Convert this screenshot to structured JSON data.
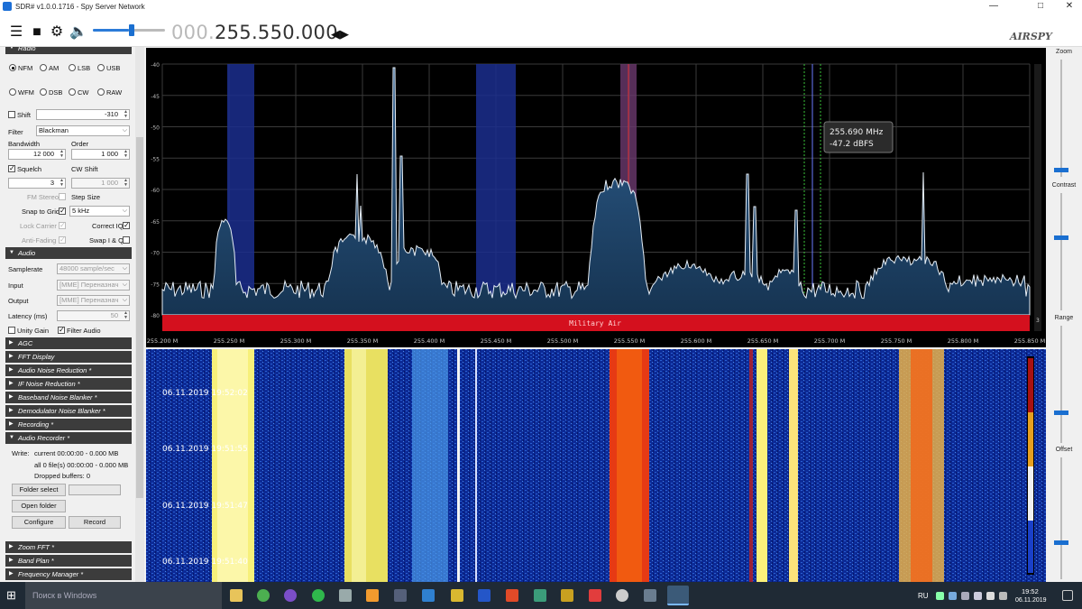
{
  "window": {
    "title": "SDR# v1.0.0.1716 - Spy Server Network",
    "minimize": "—",
    "maximize": "□",
    "close": "✕"
  },
  "toolbar": {
    "freq_dim": "000.",
    "freq_main": "255.550.000",
    "freq_arrows": "◀▶",
    "logo": "AIRSPY",
    "volume_level": 0.5
  },
  "radio": {
    "panel_title": "Radio",
    "modes": [
      "NFM",
      "AM",
      "LSB",
      "USB",
      "WFM",
      "DSB",
      "CW",
      "RAW"
    ],
    "selected_mode": "NFM",
    "shift_label": "Shift",
    "shift_value": "-310",
    "filter_label": "Filter",
    "filter_value": "Blackman",
    "bandwidth_label": "Bandwidth",
    "bandwidth_value": "12 000",
    "order_label": "Order",
    "order_value": "1 000",
    "squelch_label": "Squelch",
    "squelch_value": "3",
    "cw_shift_label": "CW Shift",
    "cw_shift_value": "1 000",
    "fm_stereo_label": "FM Stereo",
    "step_size_label": "Step Size",
    "snap_label": "Snap to Grid",
    "snap_value": "5 kHz",
    "lock_carrier_label": "Lock Carrier",
    "correct_iq_label": "Correct IQ",
    "anti_fading_label": "Anti-Fading",
    "swap_iq_label": "Swap I & Q"
  },
  "audio": {
    "panel_title": "Audio",
    "samplerate_label": "Samplerate",
    "samplerate_value": "48000 sample/sec",
    "input_label": "Input",
    "input_value": "[MME] Переназнач",
    "output_label": "Output",
    "output_value": "[MME] Переназнач",
    "latency_label": "Latency (ms)",
    "latency_value": "50",
    "unity_gain_label": "Unity Gain",
    "filter_audio_label": "Filter Audio"
  },
  "panels": [
    "AGC",
    "FFT Display",
    "Audio Noise Reduction *",
    "IF Noise Reduction *",
    "Baseband Noise Blanker *",
    "Demodulator Noise Blanker *",
    "Recording *"
  ],
  "recorder": {
    "panel_title": "Audio Recorder *",
    "write_label": "Write:",
    "current": "current 00:00:00 - 0.000 MB",
    "all": "all 0 file(s) 00:00:00 - 0.000 MB",
    "dropped": "Dropped buffers: 0",
    "folder_select": "Folder select",
    "open_folder": "Open folder",
    "configure": "Configure",
    "record": "Record"
  },
  "panels_bottom": [
    "Zoom FFT *",
    "Band Plan *",
    "Frequency Manager *"
  ],
  "spectrum": {
    "y_ticks": [
      "-40",
      "-45",
      "-50",
      "-55",
      "-60",
      "-65",
      "-70",
      "-75",
      "-80"
    ],
    "x_ticks": [
      "255.200 M",
      "255.250 M",
      "255.300 M",
      "255.350 M",
      "255.400 M",
      "255.450 M",
      "255.500 M",
      "255.550 M",
      "255.600 M",
      "255.650 M",
      "255.700 M",
      "255.750 M",
      "255.800 M",
      "255.850 M"
    ],
    "band_label": "Military Air",
    "cursor_freq": "255.690 MHz",
    "cursor_level": "-47.2 dBFS"
  },
  "waterfall": {
    "timestamps": [
      "06.11.2019 19:52:02",
      "06.11.2019 19:51:55",
      "06.11.2019 19:51:47",
      "06.11.2019 19:51:40"
    ]
  },
  "right_panel": {
    "zoom": "Zoom",
    "contrast": "Contrast",
    "range": "Range",
    "offset": "Offset",
    "range_value": "3"
  },
  "taskbar": {
    "search": "Поиск в Windows",
    "lang": "RU",
    "time": "19:52",
    "date": "06.11.2019"
  }
}
